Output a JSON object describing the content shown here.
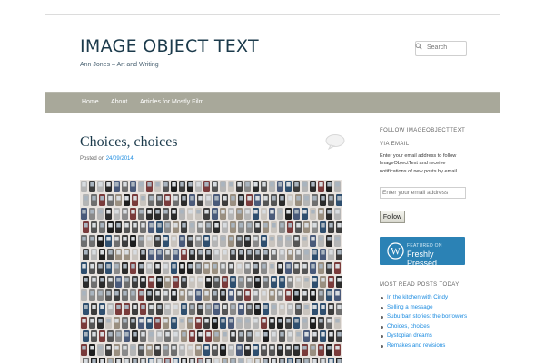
{
  "site": {
    "title": "IMAGE OBJECT TEXT",
    "tagline": "Ann Jones – Art and Writing"
  },
  "search": {
    "placeholder": "Search"
  },
  "nav": {
    "items": [
      "Home",
      "About",
      "Articles for Mostly Film"
    ]
  },
  "post": {
    "title": "Choices, choices",
    "posted_on_label": "Posted on",
    "date": "24/09/2014"
  },
  "sidebar": {
    "follow_heading": "FOLLOW IMAGEOBJECTTEXT",
    "via_email_heading": "VIA EMAIL",
    "follow_text": "Enter your email address to follow ImageObjectText and receive notifications of new posts by email.",
    "email_placeholder": "Enter your email address",
    "follow_button": "Follow",
    "badge_small": "FEATURED ON",
    "badge_big": "Freshly Pressed",
    "most_read_heading": "MOST READ POSTS TODAY",
    "most_read": [
      "In the kitchen with Cindy",
      "Selling a message",
      "Suburban stories: the borrowers",
      "Choices, choices",
      "Dystopian dreams",
      "Remakes and revisions"
    ]
  },
  "colors": {
    "nav_bar": "#a8a89a",
    "title_text": "#1b3a4b",
    "link": "#1b8be0",
    "badge": "#2b82b5"
  },
  "icons": [
    "search-icon",
    "comment-bubble-icon",
    "wordpress-logo-icon"
  ]
}
